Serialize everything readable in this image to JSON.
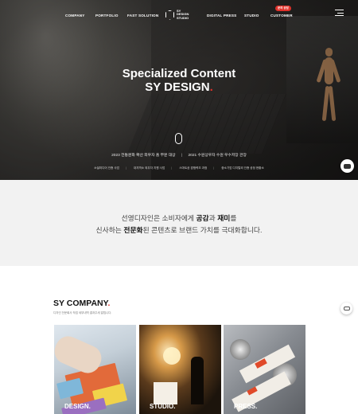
{
  "nav": {
    "items": [
      "COMPANY",
      "PORTFOLIO",
      "FAST SOLUTION",
      "DIGITAL PRESS",
      "STUDIO",
      "CUSTOMER"
    ],
    "logo_lines": [
      "SY",
      "DESIGN",
      "STUDIO"
    ],
    "customer_badge": "문의 상담"
  },
  "hero": {
    "title_line1": "Specialized Content",
    "title_line2": "SY DESIGN",
    "title_dot": ".",
    "award1": "2023 전통문화 확산 외우자 홈 부문 대상",
    "award2": "2021 수원상우자 수원 우수저장 관장",
    "subawards": [
      "소셜미디어 인증 사업",
      "대지역소 외우자 지원 사업",
      "스마트공 경쟁력조 과정",
      "중소기업 디지털외 인증 공정 현황소"
    ]
  },
  "intro": {
    "line1_a": "선영디자인은 소비자에게 ",
    "line1_b": "공감",
    "line1_c": "과 ",
    "line1_d": "재미",
    "line1_e": "를",
    "line2_a": "신사하는 ",
    "line2_b": "전문화",
    "line2_c": "된 콘텐츠로 브랜드 가치를 극대화합니다."
  },
  "company": {
    "title": "SY COMPANY",
    "title_dot": ".",
    "subtitle": "디자인 전문회사 작업 세부내역 결과주세 알립니다.",
    "cards": [
      "DESIGN.",
      "STUDIO.",
      "PRESS."
    ]
  },
  "colors": {
    "accent": "#e0312a",
    "intro_bg": "#f2f2f2"
  }
}
